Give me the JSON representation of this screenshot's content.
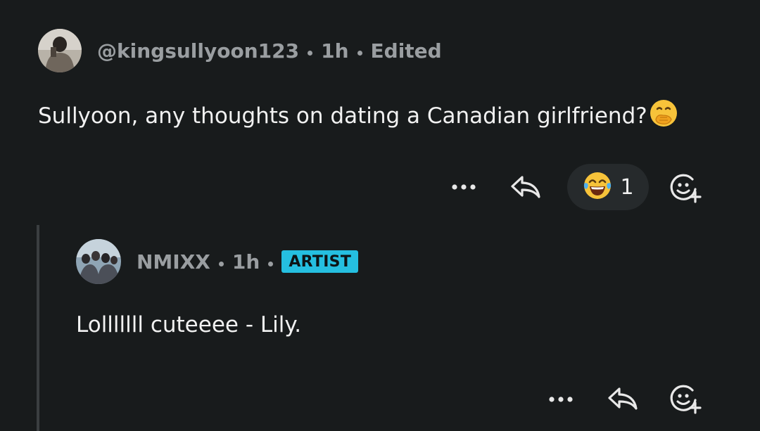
{
  "comment": {
    "username": "@kingsullyoon123",
    "time": "1h",
    "edited": "Edited",
    "text": "Sullyoon, any thoughts on dating a Canadian girlfriend?",
    "text_emoji": "face-with-hand-over-mouth",
    "reaction": {
      "emoji": "laughing-tears",
      "count": "1"
    }
  },
  "reply": {
    "username": "NMIXX",
    "time": "1h",
    "badge": "ARTIST",
    "text": "Lolllllll cuteeee - Lily."
  },
  "icons": {
    "more": "more-icon",
    "reply": "reply-icon",
    "add_reaction": "add-reaction-icon"
  },
  "colors": {
    "background": "#181b1c",
    "meta_text": "#9a9ea1",
    "badge": "#25bfe0",
    "pill": "#262a2c"
  }
}
